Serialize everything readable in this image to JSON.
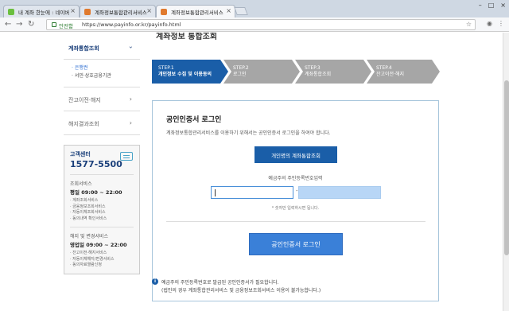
{
  "browser": {
    "tabs": [
      {
        "title": "내 계좌 한눈에 : 네이버",
        "icon_color": "#6bbf3f"
      },
      {
        "title": "계좌정보통합관리서비스",
        "icon_color": "#e07a2e"
      },
      {
        "title": "계좌정보통합관리서비스",
        "icon_color": "#e07a2e"
      }
    ],
    "secure_label": "안전함",
    "url": "https://www.payinfo.or.kr/payinfo.html"
  },
  "page_title": "계좌정보 통합조회",
  "sidebar": {
    "menu1": "계좌통합조회",
    "submenu": [
      "· 은행권",
      "· 서민·상호금융기관"
    ],
    "menu2": "잔고이전·해지",
    "menu3": "해지결과조회",
    "chevron": "›",
    "customer_center": {
      "label": "고객센터",
      "phone": "1577-5500",
      "section1_title": "조회서비스",
      "section1_hours": "평일 09:00 ~ 22:00",
      "section1_items": [
        "· 계좌조회서비스",
        "· 금융정보조회서비스",
        "· 자동이체조회서비스",
        "· 동의내역 확인서비스"
      ],
      "section2_title": "해지 및 변경서비스",
      "section2_hours": "영업일 09:00 ~ 22:00",
      "section2_items": [
        "· 잔고이전·해지서비스",
        "· 자동이체해지/변경서비스",
        "· 동의자료열람신청"
      ]
    }
  },
  "steps": [
    {
      "num": "STEP.1",
      "label": "개인정보 수집 및 이용동의",
      "active": true
    },
    {
      "num": "STEP.2",
      "label": "로그인",
      "active": false
    },
    {
      "num": "STEP.3",
      "label": "계좌통합조회",
      "active": false
    },
    {
      "num": "STEP.4",
      "label": "잔고이전·해지",
      "active": false
    }
  ],
  "login": {
    "title": "공인인증서 로그인",
    "description": "계좌정보통합관리서비스를 이용하기 위해서는 공인인증서 로그인을 하여야 합니다.",
    "personal_button": "개인명의 계좌통합조회",
    "rrn_label": "예금주의 주민등록번호입력",
    "rrn_dash": "-",
    "rrn_hint": "* 숫자만 입력하시면 됩니다.",
    "login_button": "공인인증서 로그인"
  },
  "notice": {
    "icon": "i",
    "line1": "예금주의 주민등록번호로 발급된 공인인증서가 필요합니다.",
    "line2": "(법인의 경우 계좌통합관리서비스 및 금융정보조회서비스 이용이 불가능합니다.)"
  },
  "colors": {
    "step_active": "#1a5ea8",
    "step_inactive": "#a6a6a6",
    "primary": "#1a5ea8",
    "login_button": "#3a80d8"
  }
}
